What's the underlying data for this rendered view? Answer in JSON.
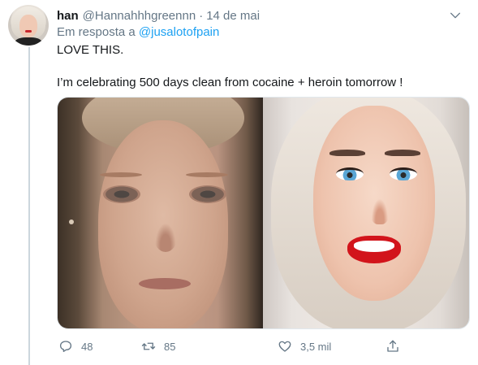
{
  "tweet": {
    "name": "han",
    "handle": "@Hannahhhgreennn",
    "separator": "·",
    "time": "14 de mai",
    "reply_prefix": "Em resposta a ",
    "reply_to": "@jusalotofpain",
    "text_line1": "LOVE THIS.",
    "text_line2": "I’m celebrating 500 days clean from cocaine + heroin tomorrow !"
  },
  "actions": {
    "replies": "48",
    "retweets": "85",
    "likes": "3,5 mil"
  },
  "icons": {
    "menu": "chevron-down-icon",
    "reply": "reply-icon",
    "retweet": "retweet-icon",
    "like": "heart-icon",
    "share": "share-icon"
  },
  "colors": {
    "link": "#1da1f2",
    "secondary_text": "#657786",
    "primary_text": "#14171a"
  }
}
